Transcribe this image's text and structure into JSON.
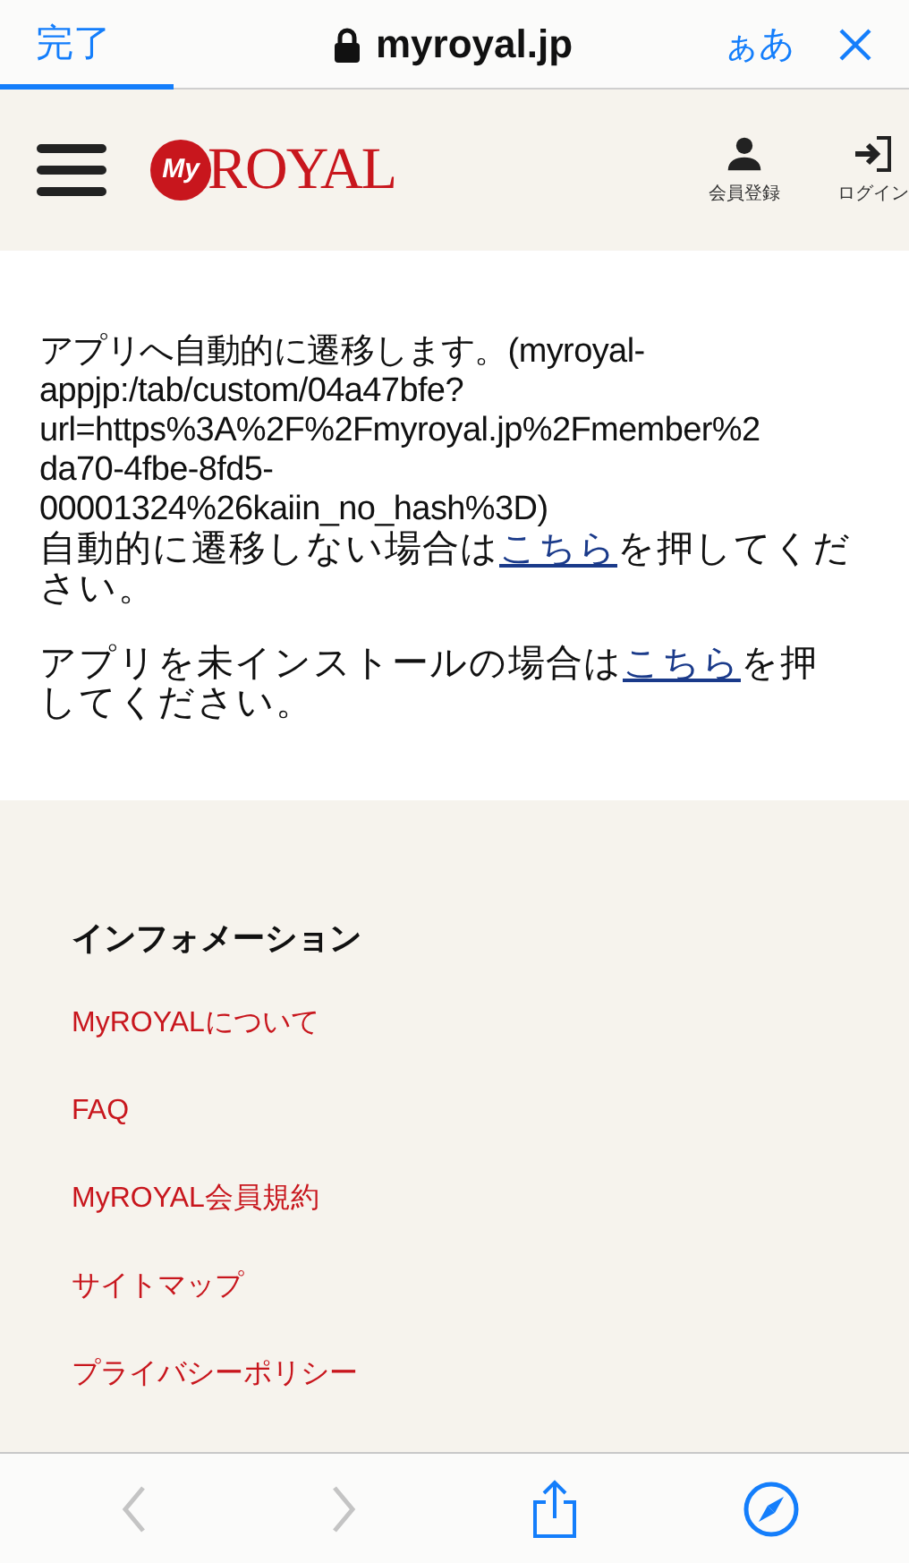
{
  "browser_bar": {
    "done": "完了",
    "url": "myroyal.jp",
    "text_size": "ぁあ",
    "progress": {
      "level": 0.19
    }
  },
  "header": {
    "logo": {
      "badge": "My",
      "word": "ROYAL"
    },
    "actions": [
      {
        "kind": "user",
        "label": "会員登録"
      },
      {
        "kind": "login",
        "label": "ログイン"
      }
    ]
  },
  "message": {
    "redirect": "アプリへ自動的に遷移します。(myroyal-\nappjp:/tab/custom/04a47bfe?\nurl=https%3A%2F%2Fmyroyal.jp%2Fmember%2\nda70-4fbe-8fd5-\n00001324%26kaiin_no_hash%3D)",
    "fallback": {
      "before": "自動的に遷移しない場合は",
      "link": "こちら",
      "after": "を押してください。"
    },
    "install": {
      "before": "アプリを未インストールの場合は",
      "link": "こちら",
      "after": "を押してください。"
    }
  },
  "footer": {
    "heading": "インフォメーション",
    "links": [
      "MyROYALについて",
      "FAQ",
      "MyROYAL会員規約",
      "サイトマップ",
      "プライバシーポリシー"
    ]
  },
  "toolbar": {
    "back": {
      "disabled": true
    },
    "forward": {
      "disabled": true
    }
  }
}
